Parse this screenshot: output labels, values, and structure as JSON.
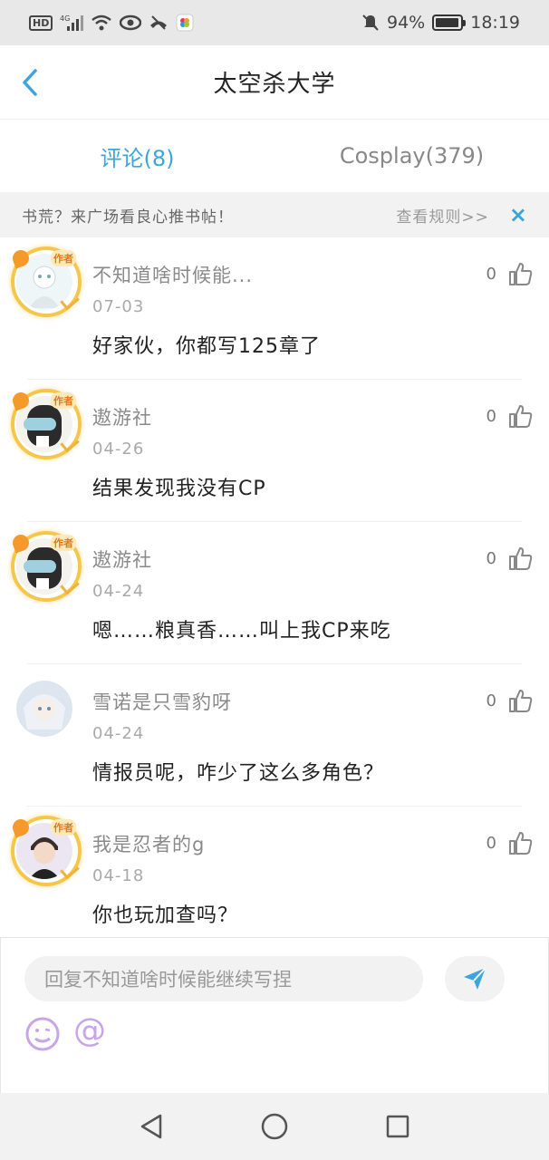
{
  "status_bar": {
    "hd": "HD",
    "network": "4G",
    "battery_percent": "94%",
    "battery_level": 0.94,
    "time": "18:19",
    "icons": [
      "hd-icon",
      "signal-icon",
      "wifi-icon",
      "eye-icon",
      "call-off-icon",
      "app-icon",
      "mute-icon",
      "battery-icon"
    ]
  },
  "header": {
    "title": "太空杀大学"
  },
  "tabs": [
    {
      "label": "评论(8)",
      "active": true
    },
    {
      "label": "Cosplay(379)",
      "active": false
    }
  ],
  "notice": {
    "text": "书荒？来广场看良心推书帖！",
    "link": "查看规则>>",
    "close": "×"
  },
  "comments": [
    {
      "username": "不知道啥时候能...",
      "date": "07-03",
      "content": "好家伙，你都写125章了",
      "likes": "0",
      "author_frame": true,
      "avatar": "avatar-1"
    },
    {
      "username": "遨游社",
      "date": "04-26",
      "content": "结果发现我没有CP",
      "likes": "0",
      "author_frame": true,
      "avatar": "avatar-2"
    },
    {
      "username": "遨游社",
      "date": "04-24",
      "content": "嗯……粮真香……叫上我CP来吃",
      "likes": "0",
      "author_frame": true,
      "avatar": "avatar-2"
    },
    {
      "username": "雪诺是只雪豹呀",
      "date": "04-24",
      "content": "情报员呢，咋少了这么多角色？",
      "likes": "0",
      "author_frame": false,
      "avatar": "avatar-3"
    },
    {
      "username": "我是忍者的g",
      "date": "04-18",
      "content": "你也玩加查吗？",
      "likes": "0",
      "author_frame": true,
      "avatar": "avatar-4"
    }
  ],
  "frame_badge": "作者",
  "reply": {
    "placeholder": "回复不知道啥时候能继续写捏"
  },
  "colors": {
    "accent": "#3aa6dc",
    "frame": "#f6c64a"
  }
}
